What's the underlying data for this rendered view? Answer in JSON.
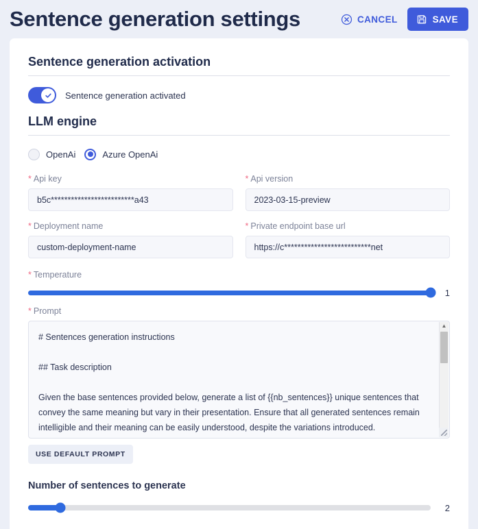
{
  "header": {
    "title": "Sentence generation settings",
    "cancel_label": "CANCEL",
    "save_label": "SAVE",
    "cancel_icon": "circle-x-icon",
    "save_icon": "floppy-disk-icon",
    "accent_color": "#3f5bdb"
  },
  "activation": {
    "section_title": "Sentence generation activation",
    "toggle_label": "Sentence generation activated",
    "toggle_on": true,
    "toggle_icon": "check-icon"
  },
  "engine": {
    "section_title": "LLM engine",
    "options": [
      {
        "label": "OpenAi",
        "selected": false
      },
      {
        "label": "Azure OpenAi",
        "selected": true
      }
    ]
  },
  "fields": {
    "api_key": {
      "label": "Api key",
      "required_mark": "*",
      "value": "b5c*************************a43"
    },
    "api_version": {
      "label": "Api version",
      "required_mark": "*",
      "value": "2023-03-15-preview"
    },
    "deployment_name": {
      "label": "Deployment name",
      "required_mark": "*",
      "value": "custom-deployment-name"
    },
    "endpoint_url": {
      "label": "Private endpoint base url",
      "required_mark": "*",
      "value": "https://c**************************net"
    }
  },
  "temperature": {
    "label": "Temperature",
    "required_mark": "*",
    "value": "1",
    "percent": 100
  },
  "prompt": {
    "label": "Prompt",
    "required_mark": "*",
    "text": "# Sentences generation instructions\n\n## Task description\n\nGiven the base sentences provided below, generate a list of {{nb_sentences}} unique sentences that convey the same meaning but vary in their presentation. Ensure that all generated sentences remain intelligible and their meaning can be easily understood, despite the variations introduced.",
    "default_button_label": "USE DEFAULT PROMPT",
    "scroll_up_icon": "triangle-up-icon",
    "scroll_down_icon": "triangle-down-icon",
    "resize_icon": "resize-handle-icon"
  },
  "sentence_count": {
    "label": "Number of sentences to generate",
    "value": "2",
    "percent": 8
  }
}
